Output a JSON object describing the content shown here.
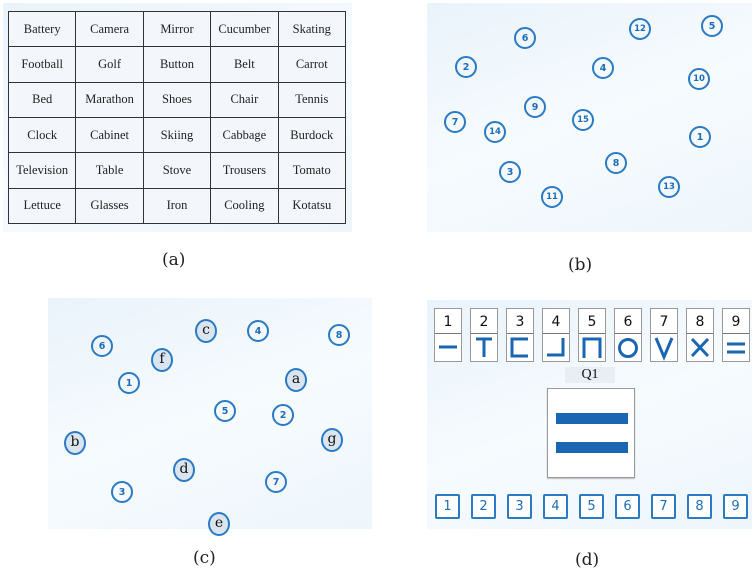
{
  "panel_a": {
    "caption": "(a)",
    "rows": [
      [
        "Battery",
        "Camera",
        "Mirror",
        "Cucumber",
        "Skating"
      ],
      [
        "Football",
        "Golf",
        "Button",
        "Belt",
        "Carrot"
      ],
      [
        "Bed",
        "Marathon",
        "Shoes",
        "Chair",
        "Tennis"
      ],
      [
        "Clock",
        "Cabinet",
        "Skiing",
        "Cabbage",
        "Burdock"
      ],
      [
        "Television",
        "Table",
        "Stove",
        "Trousers",
        "Tomato"
      ],
      [
        "Lettuce",
        "Glasses",
        "Iron",
        "Cooling",
        "Kotatsu"
      ]
    ]
  },
  "panel_b": {
    "caption": "(b)",
    "circles": [
      "1",
      "2",
      "3",
      "4",
      "5",
      "6",
      "7",
      "8",
      "9",
      "10",
      "11",
      "12",
      "13",
      "14",
      "15"
    ]
  },
  "panel_c": {
    "caption": "(c)",
    "number_circles": [
      "1",
      "2",
      "3",
      "4",
      "5",
      "6",
      "7",
      "8"
    ],
    "letter_circles": [
      "a",
      "b",
      "c",
      "d",
      "e",
      "f",
      "g"
    ]
  },
  "panel_d": {
    "caption": "(d)",
    "key_numbers": [
      "1",
      "2",
      "3",
      "4",
      "5",
      "6",
      "7",
      "8",
      "9"
    ],
    "key_symbols": [
      "horizontal-line",
      "t-shape",
      "left-bracket",
      "corner-shape",
      "pi-shape",
      "circle",
      "v-shape",
      "x-shape",
      "double-line"
    ],
    "question_label": "Q1",
    "question_symbol": "double-line",
    "answer_buttons": [
      "1",
      "2",
      "3",
      "4",
      "5",
      "6",
      "7",
      "8",
      "9"
    ],
    "accent_color": "#1a66b3"
  }
}
